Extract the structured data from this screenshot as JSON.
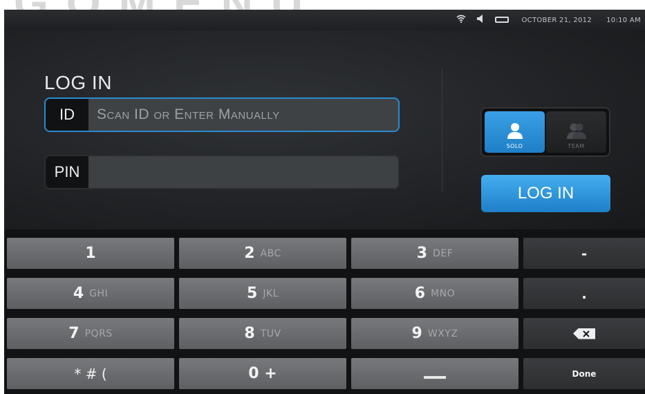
{
  "status_bar": {
    "date": "OCTOBER 21, 2012",
    "time": "10:10 AM",
    "icons": [
      "wifi-icon",
      "speaker-icon",
      "battery-icon"
    ]
  },
  "login_panel": {
    "title": "LOG IN",
    "id_field": {
      "label": "ID",
      "value": "",
      "placeholder": "Scan ID or Enter Manually"
    },
    "pin_field": {
      "label": "PIN",
      "value": "",
      "placeholder": ""
    },
    "mode_toggle": {
      "options": [
        {
          "label": "SOLO",
          "icon": "single-person-icon",
          "selected": true
        },
        {
          "label": "TEAM",
          "icon": "team-icon",
          "selected": false
        }
      ]
    },
    "login_button": "LOG IN"
  },
  "keypad": {
    "rows": [
      [
        {
          "digit": "1",
          "letters": ""
        },
        {
          "digit": "2",
          "letters": "ABC"
        },
        {
          "digit": "3",
          "letters": "DEF"
        },
        {
          "fn": "-"
        }
      ],
      [
        {
          "digit": "4",
          "letters": "GHI"
        },
        {
          "digit": "5",
          "letters": "JKL"
        },
        {
          "digit": "6",
          "letters": "MNO"
        },
        {
          "fn": "."
        }
      ],
      [
        {
          "digit": "7",
          "letters": "PQRS"
        },
        {
          "digit": "8",
          "letters": "TUV"
        },
        {
          "digit": "9",
          "letters": "WXYZ"
        },
        {
          "fn": "backspace-icon"
        }
      ],
      [
        {
          "digit": "* # (",
          "letters": ""
        },
        {
          "digit": "0 +",
          "letters": ""
        },
        {
          "fn": "space-icon"
        },
        {
          "fn": "Done"
        }
      ]
    ]
  },
  "colors": {
    "accent": "#2c8bd0",
    "key_number": "#6a6c6f",
    "key_function": "#333537",
    "background": "#1d1f22"
  }
}
